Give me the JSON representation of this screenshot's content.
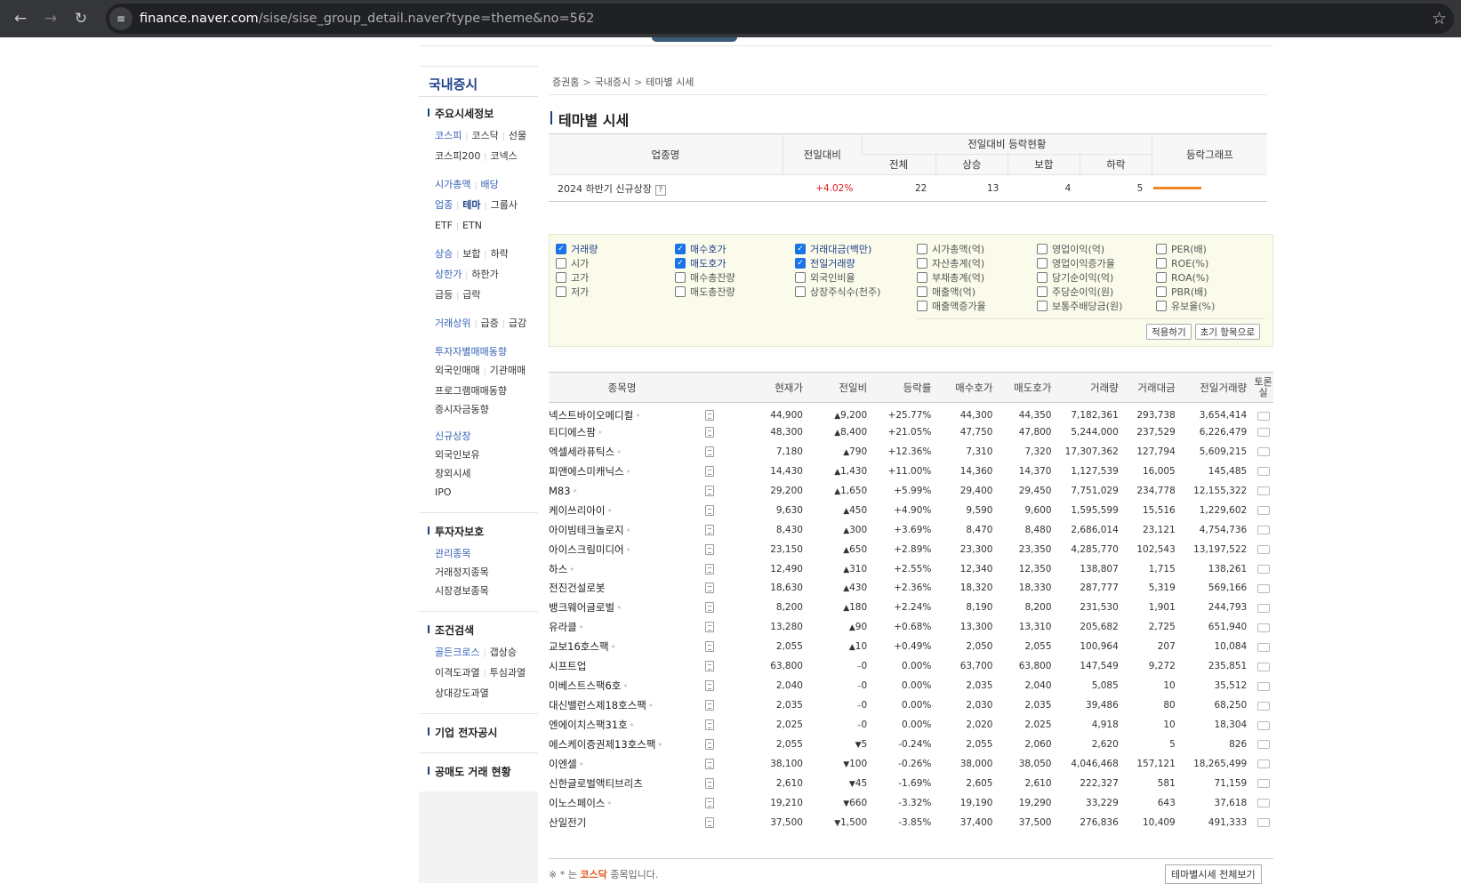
{
  "browser": {
    "url_host": "finance.naver.com",
    "url_path": "/sise/sise_group_detail.naver?type=theme&no=562"
  },
  "lnb": {
    "header": "국내증시",
    "sec1_title": "주요시세정보",
    "row1": [
      "코스피",
      "코스닥",
      "선물"
    ],
    "row2": [
      "코스피200",
      "코넥스"
    ],
    "row3": [
      "시가총액",
      "배당"
    ],
    "row4": [
      "업종",
      "테마",
      "그룹사"
    ],
    "row5": [
      "ETF",
      "ETN"
    ],
    "row6": [
      "상승",
      "보합",
      "하락"
    ],
    "row7": [
      "상한가",
      "하한가"
    ],
    "row8": [
      "급등",
      "급락"
    ],
    "row9": [
      "거래상위",
      "급증",
      "급감"
    ],
    "row10": "투자자별매매동향",
    "row11": [
      "외국인매매",
      "기관매매"
    ],
    "row12": "프로그램매매동향",
    "row13": "증시자금동향",
    "row14": "신규상장",
    "row15": "외국인보유",
    "row16": "장외시세",
    "row17": "IPO",
    "sec2_title": "투자자보호",
    "sec2_items": [
      "관리종목",
      "거래정지종목",
      "시장경보종목"
    ],
    "sec3_title": "조건검색",
    "sec3_row1": [
      "골든크로스",
      "갭상승"
    ],
    "sec3_row2": [
      "이격도과열",
      "투심과열"
    ],
    "sec3_row3": "상대강도과열",
    "sec4_title": "기업 전자공시",
    "sec5_title": "공매도 거래 현황"
  },
  "content": {
    "breadcrumb": [
      "증권홈",
      "국내증시",
      "테마별 시세"
    ],
    "title": "테마별 시세",
    "summary": {
      "headers": {
        "name": "업종명",
        "change": "전일대비",
        "status_group": "전일대비 등락현황",
        "total": "전체",
        "up": "상승",
        "flat": "보합",
        "down": "하락",
        "graph": "등락그래프"
      },
      "row": {
        "name": "2024 하반기 신규상장",
        "help": "?",
        "change": "+4.02%",
        "total": "22",
        "up": "13",
        "flat": "4",
        "down": "5"
      }
    },
    "options": {
      "col1": [
        {
          "label": "거래량",
          "checked": true
        },
        {
          "label": "시가",
          "checked": false
        },
        {
          "label": "고가",
          "checked": false
        },
        {
          "label": "저가",
          "checked": false
        }
      ],
      "col2": [
        {
          "label": "매수호가",
          "checked": true
        },
        {
          "label": "매도호가",
          "checked": true
        },
        {
          "label": "매수총잔량",
          "checked": false
        },
        {
          "label": "매도총잔량",
          "checked": false
        }
      ],
      "col3": [
        {
          "label": "거래대금(백만)",
          "checked": true
        },
        {
          "label": "전일거래량",
          "checked": true
        },
        {
          "label": "외국인비율",
          "checked": false
        },
        {
          "label": "상장주식수(천주)",
          "checked": false
        }
      ],
      "col4": [
        {
          "label": "시가총액(억)",
          "checked": false
        },
        {
          "label": "자산총계(억)",
          "checked": false
        },
        {
          "label": "부채총계(억)",
          "checked": false
        },
        {
          "label": "매출액(억)",
          "checked": false
        },
        {
          "label": "매출액증가율",
          "checked": false
        }
      ],
      "col5": [
        {
          "label": "영업이익(억)",
          "checked": false
        },
        {
          "label": "영업이익증가율",
          "checked": false
        },
        {
          "label": "당기순이익(억)",
          "checked": false
        },
        {
          "label": "주당순이익(원)",
          "checked": false
        },
        {
          "label": "보통주배당금(원)",
          "checked": false
        }
      ],
      "col6": [
        {
          "label": "PER(배)",
          "checked": false
        },
        {
          "label": "ROE(%)",
          "checked": false
        },
        {
          "label": "ROA(%)",
          "checked": false
        },
        {
          "label": "PBR(배)",
          "checked": false
        },
        {
          "label": "유보율(%)",
          "checked": false
        }
      ],
      "apply_label": "적용하기",
      "reset_label": "초기 항목으로"
    },
    "stock_table": {
      "headers": [
        "종목명",
        "현재가",
        "전일비",
        "등락률",
        "매수호가",
        "매도호가",
        "거래량",
        "거래대금",
        "전일거래량",
        "토론실"
      ],
      "rows": [
        {
          "name": "넥스트바이오메디컬",
          "star": true,
          "price": "44,900",
          "dir": "up",
          "diff": "9,200",
          "rate": "+25.77%",
          "bid": "44,300",
          "ask": "44,350",
          "vol": "7,182,361",
          "amt": "293,738",
          "pvol": "3,654,414"
        },
        {
          "name": "티디에스팜",
          "star": true,
          "price": "48,300",
          "dir": "up",
          "diff": "8,400",
          "rate": "+21.05%",
          "bid": "47,750",
          "ask": "47,800",
          "vol": "5,244,000",
          "amt": "237,529",
          "pvol": "6,226,479"
        },
        {
          "name": "엑셀세라퓨틱스",
          "star": true,
          "price": "7,180",
          "dir": "up",
          "diff": "790",
          "rate": "+12.36%",
          "bid": "7,310",
          "ask": "7,320",
          "vol": "17,307,362",
          "amt": "127,794",
          "pvol": "5,609,215"
        },
        {
          "name": "피앤에스미캐닉스",
          "star": true,
          "price": "14,430",
          "dir": "up",
          "diff": "1,430",
          "rate": "+11.00%",
          "bid": "14,360",
          "ask": "14,370",
          "vol": "1,127,539",
          "amt": "16,005",
          "pvol": "145,485"
        },
        {
          "name": "M83",
          "star": true,
          "price": "29,200",
          "dir": "up",
          "diff": "1,650",
          "rate": "+5.99%",
          "bid": "29,400",
          "ask": "29,450",
          "vol": "7,751,029",
          "amt": "234,778",
          "pvol": "12,155,322"
        },
        {
          "name": "케이쓰리아이",
          "star": true,
          "price": "9,630",
          "dir": "up",
          "diff": "450",
          "rate": "+4.90%",
          "bid": "9,590",
          "ask": "9,600",
          "vol": "1,595,599",
          "amt": "15,516",
          "pvol": "1,229,602"
        },
        {
          "name": "아이빔테크놀로지",
          "star": true,
          "price": "8,430",
          "dir": "up",
          "diff": "300",
          "rate": "+3.69%",
          "bid": "8,470",
          "ask": "8,480",
          "vol": "2,686,014",
          "amt": "23,121",
          "pvol": "4,754,736"
        },
        {
          "name": "아이스크림미디어",
          "star": true,
          "price": "23,150",
          "dir": "up",
          "diff": "650",
          "rate": "+2.89%",
          "bid": "23,300",
          "ask": "23,350",
          "vol": "4,285,770",
          "amt": "102,543",
          "pvol": "13,197,522"
        },
        {
          "name": "하스",
          "star": true,
          "price": "12,490",
          "dir": "up",
          "diff": "310",
          "rate": "+2.55%",
          "bid": "12,340",
          "ask": "12,350",
          "vol": "138,807",
          "amt": "1,715",
          "pvol": "138,261"
        },
        {
          "name": "전진건설로봇",
          "star": false,
          "price": "18,630",
          "dir": "up",
          "diff": "430",
          "rate": "+2.36%",
          "bid": "18,320",
          "ask": "18,330",
          "vol": "287,777",
          "amt": "5,319",
          "pvol": "569,166"
        },
        {
          "name": "뱅크웨어글로벌",
          "star": true,
          "price": "8,200",
          "dir": "up",
          "diff": "180",
          "rate": "+2.24%",
          "bid": "8,190",
          "ask": "8,200",
          "vol": "231,530",
          "amt": "1,901",
          "pvol": "244,793"
        },
        {
          "name": "유라클",
          "star": true,
          "price": "13,280",
          "dir": "up",
          "diff": "90",
          "rate": "+0.68%",
          "bid": "13,300",
          "ask": "13,310",
          "vol": "205,682",
          "amt": "2,725",
          "pvol": "651,940"
        },
        {
          "name": "교보16호스팩",
          "star": true,
          "price": "2,055",
          "dir": "up",
          "diff": "10",
          "rate": "+0.49%",
          "bid": "2,050",
          "ask": "2,055",
          "vol": "100,964",
          "amt": "207",
          "pvol": "10,084"
        },
        {
          "name": "시프트업",
          "star": false,
          "price": "63,800",
          "dir": "flat",
          "diff": "0",
          "rate": "0.00%",
          "bid": "63,700",
          "ask": "63,800",
          "vol": "147,549",
          "amt": "9,272",
          "pvol": "235,851"
        },
        {
          "name": "이베스트스팩6호",
          "star": true,
          "price": "2,040",
          "dir": "flat",
          "diff": "0",
          "rate": "0.00%",
          "bid": "2,035",
          "ask": "2,040",
          "vol": "5,085",
          "amt": "10",
          "pvol": "35,512"
        },
        {
          "name": "대신밸런스제18호스팩",
          "star": true,
          "price": "2,035",
          "dir": "flat",
          "diff": "0",
          "rate": "0.00%",
          "bid": "2,030",
          "ask": "2,035",
          "vol": "39,486",
          "amt": "80",
          "pvol": "68,250"
        },
        {
          "name": "엔에이치스팩31호",
          "star": true,
          "price": "2,025",
          "dir": "flat",
          "diff": "0",
          "rate": "0.00%",
          "bid": "2,020",
          "ask": "2,025",
          "vol": "4,918",
          "amt": "10",
          "pvol": "18,304"
        },
        {
          "name": "에스케이증권제13호스팩",
          "star": true,
          "price": "2,055",
          "dir": "dn",
          "diff": "5",
          "rate": "-0.24%",
          "bid": "2,055",
          "ask": "2,060",
          "vol": "2,620",
          "amt": "5",
          "pvol": "826"
        },
        {
          "name": "이엔셀",
          "star": true,
          "price": "38,100",
          "dir": "dn",
          "diff": "100",
          "rate": "-0.26%",
          "bid": "38,000",
          "ask": "38,050",
          "vol": "4,046,468",
          "amt": "157,121",
          "pvol": "18,265,499"
        },
        {
          "name": "신한글로벌액티브리츠",
          "star": false,
          "price": "2,610",
          "dir": "dn",
          "diff": "45",
          "rate": "-1.69%",
          "bid": "2,605",
          "ask": "2,610",
          "vol": "222,327",
          "amt": "581",
          "pvol": "71,159"
        },
        {
          "name": "이노스페이스",
          "star": true,
          "price": "19,210",
          "dir": "dn",
          "diff": "660",
          "rate": "-3.32%",
          "bid": "19,190",
          "ask": "19,290",
          "vol": "33,229",
          "amt": "643",
          "pvol": "37,618"
        },
        {
          "name": "산일전기",
          "star": false,
          "price": "37,500",
          "dir": "dn",
          "diff": "1,500",
          "rate": "-3.85%",
          "bid": "37,400",
          "ask": "37,500",
          "vol": "276,836",
          "amt": "10,409",
          "pvol": "491,333"
        }
      ]
    },
    "note_prefix": "※ * 는",
    "note_kosdaq": "코스닥",
    "note_suffix": "종목입니다.",
    "all_button": "테마별시세 전체보기"
  },
  "colors": {
    "up": "#e01b1b",
    "down": "#1a5fd8",
    "accent": "#1d3f8a",
    "graph": "#f08620"
  }
}
